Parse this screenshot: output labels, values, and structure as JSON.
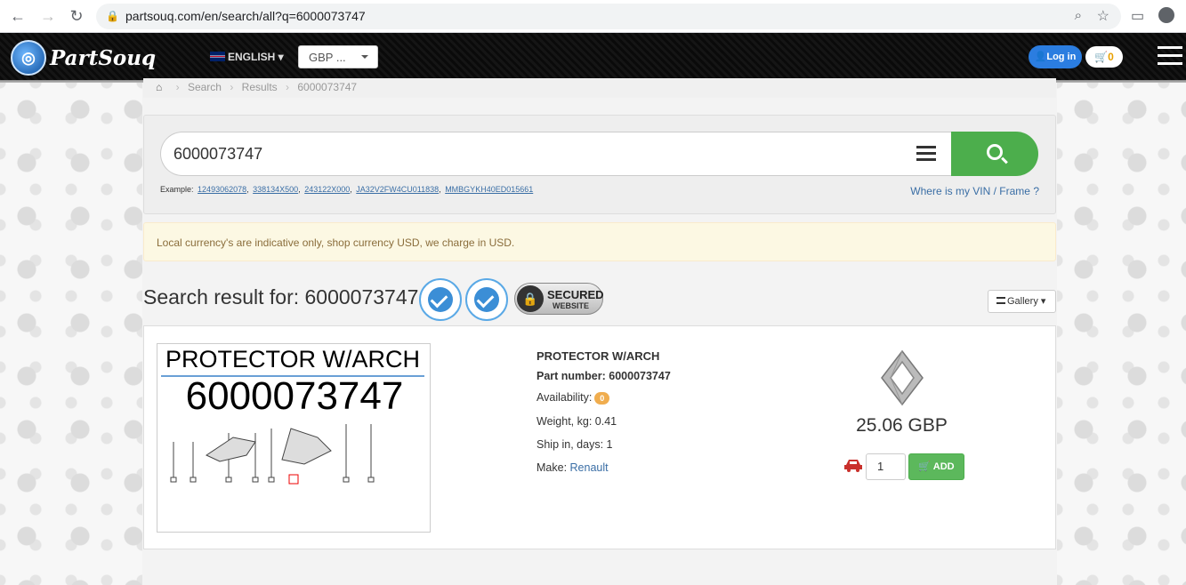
{
  "browser": {
    "url": "partsouq.com/en/search/all?q=6000073747"
  },
  "header": {
    "logo_text": "PartSouq",
    "language": "ENGLISH",
    "currency": "GBP ...",
    "login_label": "Log in",
    "cart_count": "0"
  },
  "breadcrumb": {
    "items": [
      "Search",
      "Results",
      "6000073747"
    ]
  },
  "search": {
    "value": "6000073747",
    "example_label": "Example:",
    "examples": [
      "12493062078",
      "338134X500",
      "243122X000",
      "JA32V2FW4CU011838",
      "MMBGYKH40ED015661"
    ],
    "vin_link": "Where is my VIN / Frame ?"
  },
  "alert": {
    "text": "Local currency's are indicative only, shop currency USD, we charge in USD."
  },
  "results": {
    "title": "Search result for: 6000073747",
    "secured_line1": "SECURED",
    "secured_line2": "WEBSITE",
    "view_label": "Gallery"
  },
  "product": {
    "thumb_name": "PROTECTOR W/ARCH",
    "thumb_number": "6000073747",
    "name": "PROTECTOR W/ARCH",
    "part_number": "Part number: 6000073747",
    "availability_label": "Availability:",
    "availability_count": "0",
    "weight": "Weight, kg: 0.41",
    "ship": "Ship in, days: 1",
    "make_label": "Make:",
    "make": "Renault",
    "price": "25.06 GBP",
    "quantity": "1",
    "add_label": "ADD"
  },
  "colors": {
    "accent_green": "#5cb85c",
    "link_blue": "#3a6ea5",
    "login_blue": "#2b7de0"
  }
}
